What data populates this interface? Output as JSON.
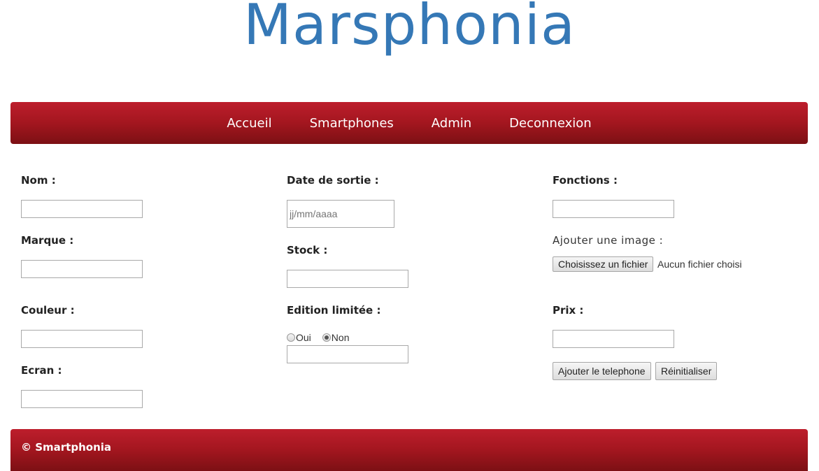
{
  "site": {
    "title": "Marsphonia"
  },
  "nav": {
    "items": [
      {
        "label": "Accueil"
      },
      {
        "label": "Smartphones"
      },
      {
        "label": "Admin"
      },
      {
        "label": "Deconnexion"
      }
    ]
  },
  "form": {
    "nom": {
      "label": "Nom :",
      "value": ""
    },
    "marque": {
      "label": "Marque :",
      "value": ""
    },
    "couleur": {
      "label": "Couleur :",
      "value": ""
    },
    "ecran": {
      "label": "Ecran :",
      "value": ""
    },
    "date_sortie": {
      "label": "Date de sortie :",
      "placeholder": "jj/mm/aaaa"
    },
    "stock": {
      "label": "Stock :",
      "value": ""
    },
    "edition_limitee": {
      "label": "Edition limitée :",
      "options": [
        {
          "label": "Oui",
          "checked": false
        },
        {
          "label": "Non",
          "checked": true
        }
      ],
      "value": ""
    },
    "fonctions": {
      "label": "Fonctions :",
      "value": ""
    },
    "image": {
      "label": "Ajouter une image :",
      "button_label": "Choisissez un fichier",
      "status": "Aucun fichier choisi"
    },
    "prix": {
      "label": "Prix :",
      "value": ""
    },
    "submit_label": "Ajouter le telephone",
    "reset_label": "Réinitialiser"
  },
  "footer": {
    "text": "© Smartphonia"
  },
  "colors": {
    "title": "#3578b6",
    "bar_top": "#bd1e2c",
    "bar_bottom": "#7c1014"
  }
}
